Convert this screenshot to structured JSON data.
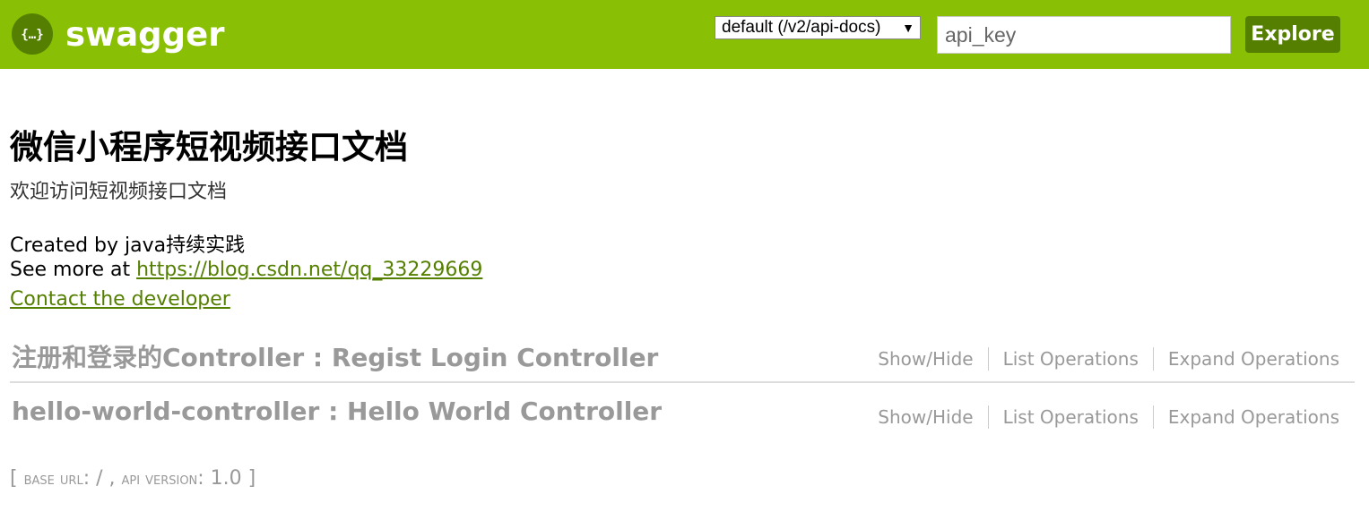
{
  "header": {
    "logo_text": "swagger",
    "spec_select": "default (/v2/api-docs)",
    "api_key_placeholder": "api_key",
    "explore_label": "Explore"
  },
  "info": {
    "title": "微信小程序短视频接口文档",
    "description": "欢迎访问短视频接口文档",
    "created_by": "Created by java持续实践",
    "see_more_prefix": "See more at ",
    "see_more_link": "https://blog.csdn.net/qq_33229669",
    "contact_link": "Contact the developer"
  },
  "resources": [
    {
      "name": "注册和登录的Controller : Regist Login Controller",
      "show_hide": "Show/Hide",
      "list_ops": "List Operations",
      "expand_ops": "Expand Operations"
    },
    {
      "name": "hello-world-controller : Hello World Controller",
      "show_hide": "Show/Hide",
      "list_ops": "List Operations",
      "expand_ops": "Expand Operations"
    }
  ],
  "footer": {
    "open": "[ ",
    "base_url_label": "base url",
    "base_url_value": ": / , ",
    "api_version_label": "api version",
    "api_version_value": ": 1.0 ]"
  },
  "colors": {
    "header_bg": "#89bf04",
    "accent_dark": "#547f00",
    "muted_text": "#999999"
  },
  "icons": {
    "logo": "swagger-braces-icon",
    "dropdown": "caret-down-icon"
  }
}
